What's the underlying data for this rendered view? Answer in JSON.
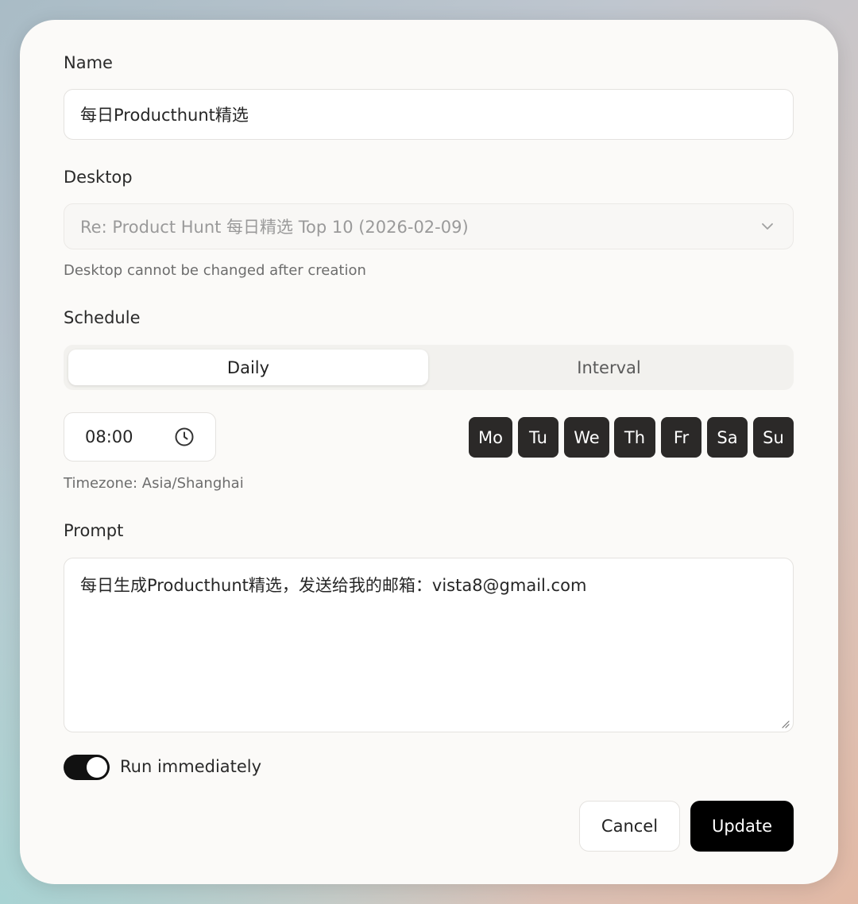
{
  "form": {
    "name_label": "Name",
    "name_value": "每日Producthunt精选",
    "desktop_label": "Desktop",
    "desktop_value": "Re: Product Hunt 每日精选 Top 10 (2026-02-09)",
    "desktop_hint": "Desktop cannot be changed after creation",
    "schedule_label": "Schedule",
    "schedule_tabs": [
      "Daily",
      "Interval"
    ],
    "time_value": "08:00",
    "days": [
      "Mo",
      "Tu",
      "We",
      "Th",
      "Fr",
      "Sa",
      "Su"
    ],
    "timezone_text": "Timezone: Asia/Shanghai",
    "prompt_label": "Prompt",
    "prompt_value": "每日生成Producthunt精选，发送给我的邮箱：vista8@gmail.com",
    "run_immediately_label": "Run immediately",
    "run_immediately_on": true
  },
  "actions": {
    "cancel_label": "Cancel",
    "update_label": "Update"
  },
  "colors": {
    "accent": "#000000",
    "day_chip": "#2b2928",
    "dialog_bg": "#fbfaf8"
  },
  "icons": {
    "desktop_select": "chevron-down-icon",
    "time_picker": "clock-icon",
    "prompt_resize": "resize-handle-icon"
  }
}
